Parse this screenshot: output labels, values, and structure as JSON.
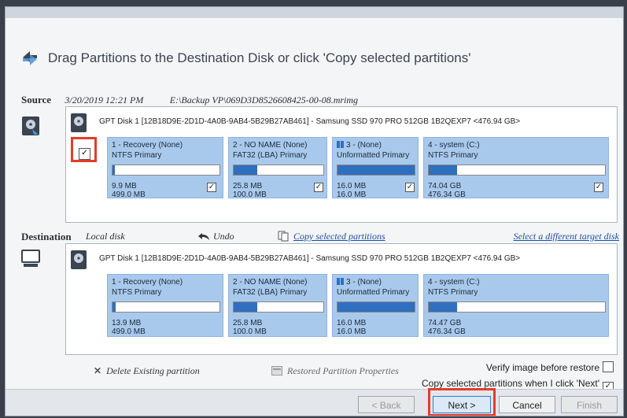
{
  "header": {
    "title": "Drag Partitions to the Destination Disk or click 'Copy selected partitions'"
  },
  "source": {
    "label": "Source",
    "datetime": "3/20/2019 12:21 PM",
    "path": "E:\\Backup VP\\069D3D8526608425-00-08.mrimg",
    "disk": "GPT Disk 1 [12B18D9E-2D1D-4A0B-9AB4-5B29B27AB461] - Samsung SSD 970 PRO 512GB 1B2QEXP7  <476.94 GB>",
    "partitions": [
      {
        "name": "1 - Recovery (None)",
        "type": "NTFS Primary",
        "used": "9.9 MB",
        "total": "499.0 MB",
        "checked": "✓",
        "fill": 0.02
      },
      {
        "name": "2 - NO NAME (None)",
        "type": "FAT32 (LBA) Primary",
        "used": "25.8 MB",
        "total": "100.0 MB",
        "checked": "✓",
        "fill": 0.26
      },
      {
        "name": "3 -  (None)",
        "type": "Unformatted Primary",
        "used": "16.0 MB",
        "total": "16.0 MB",
        "checked": "✓",
        "fill": 1.0
      },
      {
        "name": "4 - system (C:)",
        "type": "NTFS Primary",
        "used": "74.04 GB",
        "total": "476.34 GB",
        "checked": "✓",
        "fill": 0.16
      }
    ]
  },
  "destination": {
    "label": "Destination",
    "disk_name": "Local disk",
    "undo": "Undo",
    "copy_selected": "Copy selected partitions",
    "select_target": "Select a different target disk",
    "disk": "GPT Disk 1 [12B18D9E-2D1D-4A0B-9AB4-5B29B27AB461] - Samsung SSD 970 PRO 512GB 1B2QEXP7  <476.94 GB>",
    "partitions": [
      {
        "name": "1 - Recovery (None)",
        "type": "NTFS Primary",
        "used": "13.9 MB",
        "total": "499.0 MB",
        "fill": 0.03
      },
      {
        "name": "2 - NO NAME (None)",
        "type": "FAT32 (LBA) Primary",
        "used": "25.8 MB",
        "total": "100.0 MB",
        "fill": 0.26
      },
      {
        "name": "3 -  (None)",
        "type": "Unformatted Primary",
        "used": "16.0 MB",
        "total": "16.0 MB",
        "fill": 1.0
      },
      {
        "name": "4 - system (C:)",
        "type": "NTFS Primary",
        "used": "74.47 GB",
        "total": "476.34 GB",
        "fill": 0.16
      }
    ]
  },
  "actions": {
    "delete_partition": "Delete Existing partition",
    "restored_properties": "Restored Partition Properties",
    "verify_image": "Verify image before restore",
    "copy_on_next": "Copy selected partitions when I click 'Next'",
    "copy_on_next_checked": "✓"
  },
  "buttons": {
    "back": "< Back",
    "next": "Next >",
    "cancel": "Cancel",
    "finish": "Finish"
  },
  "colors": {
    "highlight": "#e23d2a",
    "partition_bg": "#a9c9ec",
    "bar_fill": "#2f6fbf",
    "link": "#1a4fa8"
  }
}
